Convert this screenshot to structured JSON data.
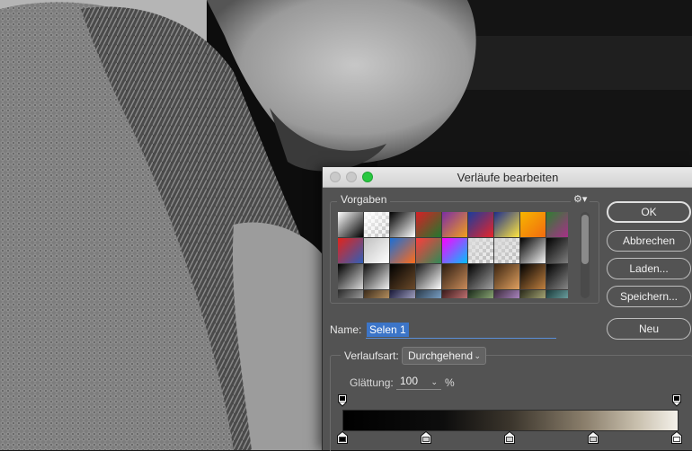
{
  "dialog": {
    "title": "Verläufe bearbeiten",
    "presets_label": "Vorgaben",
    "gear_icon": "gear-icon",
    "name_label": "Name:",
    "name_value": "Selen 1",
    "gradient_type_label": "Verlaufsart:",
    "gradient_type_value": "Durchgehend",
    "smoothness_label": "Glättung:",
    "smoothness_value": "100",
    "smoothness_unit": "%"
  },
  "buttons": {
    "ok": "OK",
    "cancel": "Abbrechen",
    "load": "Laden...",
    "save": "Speichern...",
    "new": "Neu"
  },
  "colors": {
    "dialog_bg": "#535353",
    "accent_blue": "#3c75c8",
    "traffic_green": "#28c840"
  },
  "presets": [
    [
      "#ffffff",
      "#000000"
    ],
    [
      "#ffffff",
      "#9c9c9c"
    ],
    [
      "#000000",
      "#ffffff"
    ],
    [
      "#d81f26",
      "#1f7a2e"
    ],
    [
      "#7b2ea5",
      "#f29f1c"
    ],
    [
      "#1a3c9c",
      "#e8242a"
    ],
    [
      "#1e2e8c",
      "#ffe640"
    ],
    [
      "#f7b500",
      "#f26b0f"
    ],
    [
      "#2f7d32",
      "#b12a8f"
    ],
    [
      "#e2231a",
      "#2f5fb8"
    ],
    [
      "#c0c0c0",
      "#ffffff"
    ],
    [
      "#1a6fd6",
      "#ff6b1a"
    ],
    [
      "#ff3c3c",
      "#2e8b57"
    ],
    [
      "#ff00ff",
      "#00c0ff"
    ],
    [
      "#dcdcdc",
      "#ffffff"
    ],
    [
      "#d8d8d8",
      "#f4f4f4"
    ],
    [
      "#000000",
      "#f4f4f4"
    ],
    [
      "#000000",
      "#888888"
    ],
    [
      "#000000",
      "#d8d8d8"
    ],
    [
      "#101010",
      "#f0f0f0"
    ],
    [
      "#000000",
      "#6b4a2a"
    ],
    [
      "#1a1a1a",
      "#ffffff"
    ],
    [
      "#2b1d10",
      "#c98b5a"
    ],
    [
      "#000000",
      "#a0a0a0"
    ],
    [
      "#3a2410",
      "#e0a060"
    ],
    [
      "#000000",
      "#c08040"
    ],
    [
      "#000000",
      "#909090"
    ],
    [
      "#2a2a2a",
      "#d0d0d0"
    ],
    [
      "#3a2a1a",
      "#f0c080"
    ],
    [
      "#1a1a3a",
      "#e0e0ff"
    ],
    [
      "#2a3a4a",
      "#a0d0ff"
    ],
    [
      "#3a1a1a",
      "#ff9a9a"
    ],
    [
      "#1a2a1a",
      "#c0e0a0"
    ],
    [
      "#3a2a3a",
      "#e0b0ff"
    ],
    [
      "#2a2a1a",
      "#e0e0a0"
    ],
    [
      "#1a3a3a",
      "#a0e0e0"
    ]
  ],
  "gradient_stops": [
    {
      "type": "opacity",
      "location_pct": 0
    },
    {
      "type": "opacity",
      "location_pct": 100
    },
    {
      "type": "color",
      "location_pct": 0,
      "color": "#000000"
    },
    {
      "type": "color",
      "location_pct": 25
    },
    {
      "type": "color",
      "location_pct": 50
    },
    {
      "type": "color",
      "location_pct": 75
    },
    {
      "type": "color",
      "location_pct": 100,
      "color": "#ffffff"
    }
  ]
}
